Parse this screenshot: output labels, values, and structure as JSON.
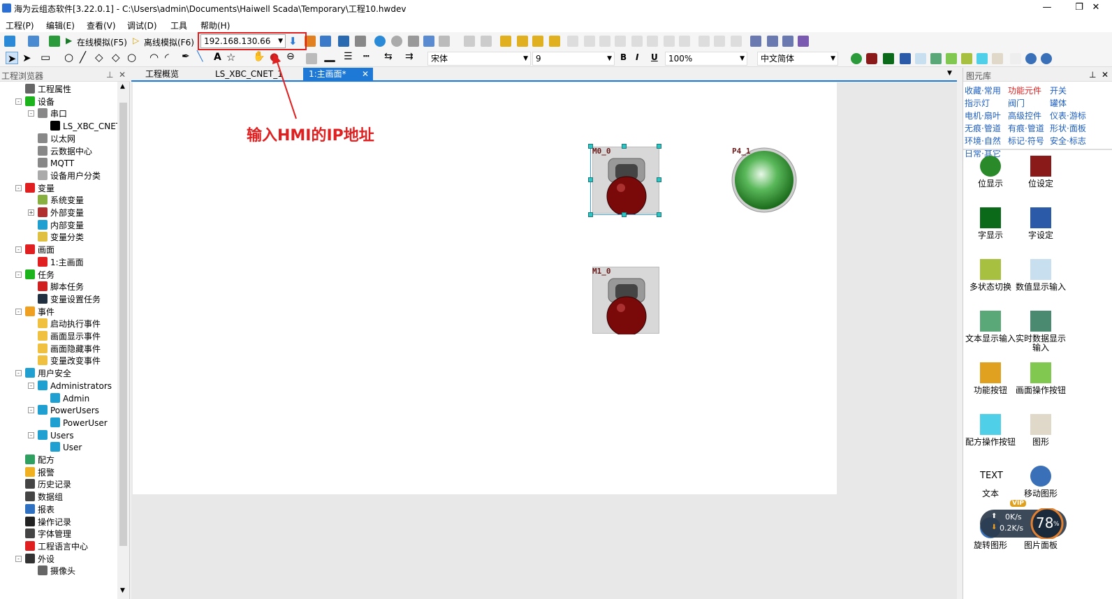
{
  "window": {
    "title": "海为云组态软件[3.22.0.1] - C:\\Users\\admin\\Documents\\Haiwell Scada\\Temporary\\工程10.hwdev",
    "minimize": "—",
    "maximize": "❐",
    "close": "✕"
  },
  "menu": [
    "工程(P)",
    "编辑(E)",
    "查看(V)",
    "调试(D)",
    "工具",
    "帮助(H)"
  ],
  "toolbar": {
    "online_sim": "在线模拟(F5)",
    "offline_sim": "离线模拟(F6)",
    "ip_value": "192.168.130.66",
    "font_name": "宋体",
    "font_size": "9",
    "bold": "B",
    "italic": "I",
    "underline": "U",
    "zoom": "100%",
    "language": "中文简体",
    "text_tool": "A"
  },
  "left_panel": {
    "title": "工程浏览器",
    "items": [
      {
        "label": "工程属性",
        "icon": "properties-icon",
        "color": "#666666"
      },
      {
        "label": "设备",
        "icon": "device-icon",
        "color": "#1db31d"
      },
      {
        "label": "串口",
        "icon": "serial-port-icon",
        "color": "#888888"
      },
      {
        "label": "LS_XBC_CNET_",
        "icon": "plc-device-icon",
        "color": "#000000"
      },
      {
        "label": "以太网",
        "icon": "ethernet-icon",
        "color": "#888888"
      },
      {
        "label": "云数据中心",
        "icon": "cloud-icon",
        "color": "#888888"
      },
      {
        "label": "MQTT",
        "icon": "mqtt-icon",
        "color": "#888888"
      },
      {
        "label": "设备用户分类",
        "icon": "category-icon",
        "color": "#aaaaaa"
      },
      {
        "label": "变量",
        "icon": "variable-icon",
        "color": "#e02020"
      },
      {
        "label": "系统变量",
        "icon": "system-variable-icon",
        "color": "#88b040"
      },
      {
        "label": "外部变量",
        "icon": "external-variable-icon",
        "color": "#b03030"
      },
      {
        "label": "内部变量",
        "icon": "internal-variable-icon",
        "color": "#20a0d0"
      },
      {
        "label": "变量分类",
        "icon": "folder-icon",
        "color": "#e0c040"
      },
      {
        "label": "画面",
        "icon": "screen-icon",
        "color": "#e02020"
      },
      {
        "label": "1:主画面",
        "icon": "main-screen-icon",
        "color": "#e02020"
      },
      {
        "label": "任务",
        "icon": "task-icon",
        "color": "#1db31d"
      },
      {
        "label": "脚本任务",
        "icon": "script-task-icon",
        "color": "#d02020"
      },
      {
        "label": "变量设置任务",
        "icon": "variable-task-icon",
        "color": "#203040"
      },
      {
        "label": "事件",
        "icon": "event-icon",
        "color": "#f0a020"
      },
      {
        "label": "启动执行事件",
        "icon": "startup-event-icon",
        "color": "#f0c040"
      },
      {
        "label": "画面显示事件",
        "icon": "screen-show-event-icon",
        "color": "#f0c040"
      },
      {
        "label": "画面隐藏事件",
        "icon": "screen-hide-event-icon",
        "color": "#f0c040"
      },
      {
        "label": "变量改变事件",
        "icon": "variable-change-event-icon",
        "color": "#f0c040"
      },
      {
        "label": "用户安全",
        "icon": "user-security-icon",
        "color": "#20a0d0"
      },
      {
        "label": "Administrators",
        "icon": "user-group-icon",
        "color": "#20a0d0"
      },
      {
        "label": "Admin",
        "icon": "user-icon",
        "color": "#20a0d0"
      },
      {
        "label": "PowerUsers",
        "icon": "user-group-icon",
        "color": "#20a0d0"
      },
      {
        "label": "PowerUser",
        "icon": "user-icon",
        "color": "#20a0d0"
      },
      {
        "label": "Users",
        "icon": "user-group-icon",
        "color": "#20a0d0"
      },
      {
        "label": "User",
        "icon": "user-icon",
        "color": "#20a0d0"
      },
      {
        "label": "配方",
        "icon": "recipe-icon",
        "color": "#30a060"
      },
      {
        "label": "报警",
        "icon": "alarm-icon",
        "color": "#f0b020"
      },
      {
        "label": "历史记录",
        "icon": "history-icon",
        "color": "#444444"
      },
      {
        "label": "数据组",
        "icon": "data-group-icon",
        "color": "#444444"
      },
      {
        "label": "报表",
        "icon": "report-icon",
        "color": "#3070c0"
      },
      {
        "label": "操作记录",
        "icon": "operation-log-icon",
        "color": "#222222"
      },
      {
        "label": "字体管理",
        "icon": "font-manager-icon",
        "color": "#444444"
      },
      {
        "label": "工程语言中心",
        "icon": "language-center-icon",
        "color": "#e02020"
      },
      {
        "label": "外设",
        "icon": "peripherals-icon",
        "color": "#333333"
      },
      {
        "label": "摄像头",
        "icon": "camera-icon",
        "color": "#666666"
      }
    ]
  },
  "tabs": [
    "工程概览",
    "LS_XBC_CNET_1",
    "1:主画面*"
  ],
  "canvas": {
    "components": [
      "M0_0",
      "P4_1",
      "M1_0"
    ],
    "annotation": "输入HMI的IP地址"
  },
  "right_panel": {
    "title": "图元库",
    "categories": [
      "收藏·常用",
      "功能元件",
      "开关",
      "指示灯",
      "阀门",
      "罐体",
      "电机·扇叶",
      "高级控件",
      "仪表·游标",
      "无痕·管道",
      "有痕·管道",
      "形状·面板",
      "环境·自然",
      "标记·符号",
      "安全·标志",
      "日常·其它"
    ],
    "active_category": "功能元件",
    "items": [
      {
        "label": "位显示",
        "color": "#2a8a2a"
      },
      {
        "label": "位设定",
        "color": "#8a1a1a"
      },
      {
        "label": "字显示",
        "color": "#0a6a1a"
      },
      {
        "label": "字设定",
        "color": "#2a5aa8"
      },
      {
        "label": "多状态切换",
        "color": "#a8c040"
      },
      {
        "label": "数值显示输入",
        "color": "#c8dff0"
      },
      {
        "label": "文本显示输入",
        "color": "#5aa878"
      },
      {
        "label": "实时数据显示输入",
        "color": "#4a8a70"
      },
      {
        "label": "功能按钮",
        "color": "#e0a020"
      },
      {
        "label": "画面操作按钮",
        "color": "#80c850"
      },
      {
        "label": "配方操作按钮",
        "color": "#50d0e8"
      },
      {
        "label": "图形",
        "color": "#e0d8c8"
      },
      {
        "label": "文本",
        "color": "#ffffff"
      },
      {
        "label": "移动图形",
        "color": "#3a70b8"
      },
      {
        "label": "旋转图形",
        "color": "#3a70b8"
      },
      {
        "label": "图片面板",
        "color": "#3a70b8"
      }
    ],
    "text_icon_label": "TEXT"
  },
  "speed_widget": {
    "up": "0K/s",
    "down": "0.2K/s",
    "percent": "78",
    "percent_sign": "%",
    "badge": "VIP"
  }
}
